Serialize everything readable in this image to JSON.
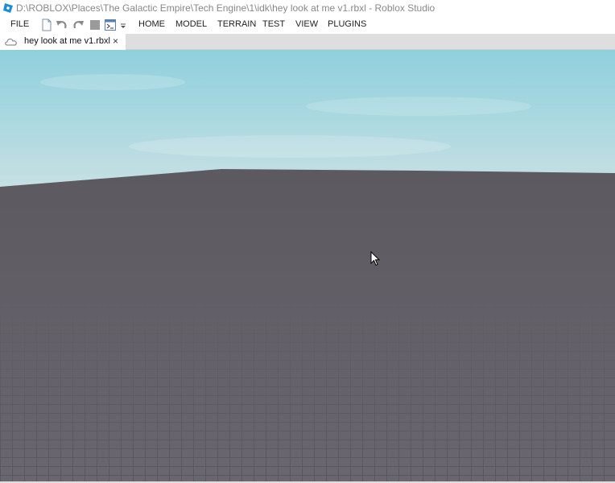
{
  "window": {
    "title": "D:\\ROBLOX\\Places\\The Galactic Empire\\Tech Engine\\1\\idk\\hey look at me v1.rbxl - Roblox Studio",
    "app_icon": "roblox-studio-icon"
  },
  "menu": {
    "file": "FILE",
    "quick_access": [
      "new-file-icon",
      "undo-icon",
      "redo-icon",
      "stop-icon",
      "script-icon",
      "customize-dropdown-icon"
    ],
    "tabs": [
      "HOME",
      "MODEL",
      "TERRAIN",
      "TEST",
      "VIEW",
      "PLUGINS"
    ]
  },
  "document_tab": {
    "icon": "cloud-icon",
    "label": "hey look at me v1.rbxl",
    "close_glyph": "×"
  },
  "viewport": {
    "sky_color_top": "#8fd0dd",
    "sky_color_horizon": "#c6e0e3",
    "baseplate_color": "#5f5a60",
    "cursor_icon": "mouse-pointer-icon"
  }
}
